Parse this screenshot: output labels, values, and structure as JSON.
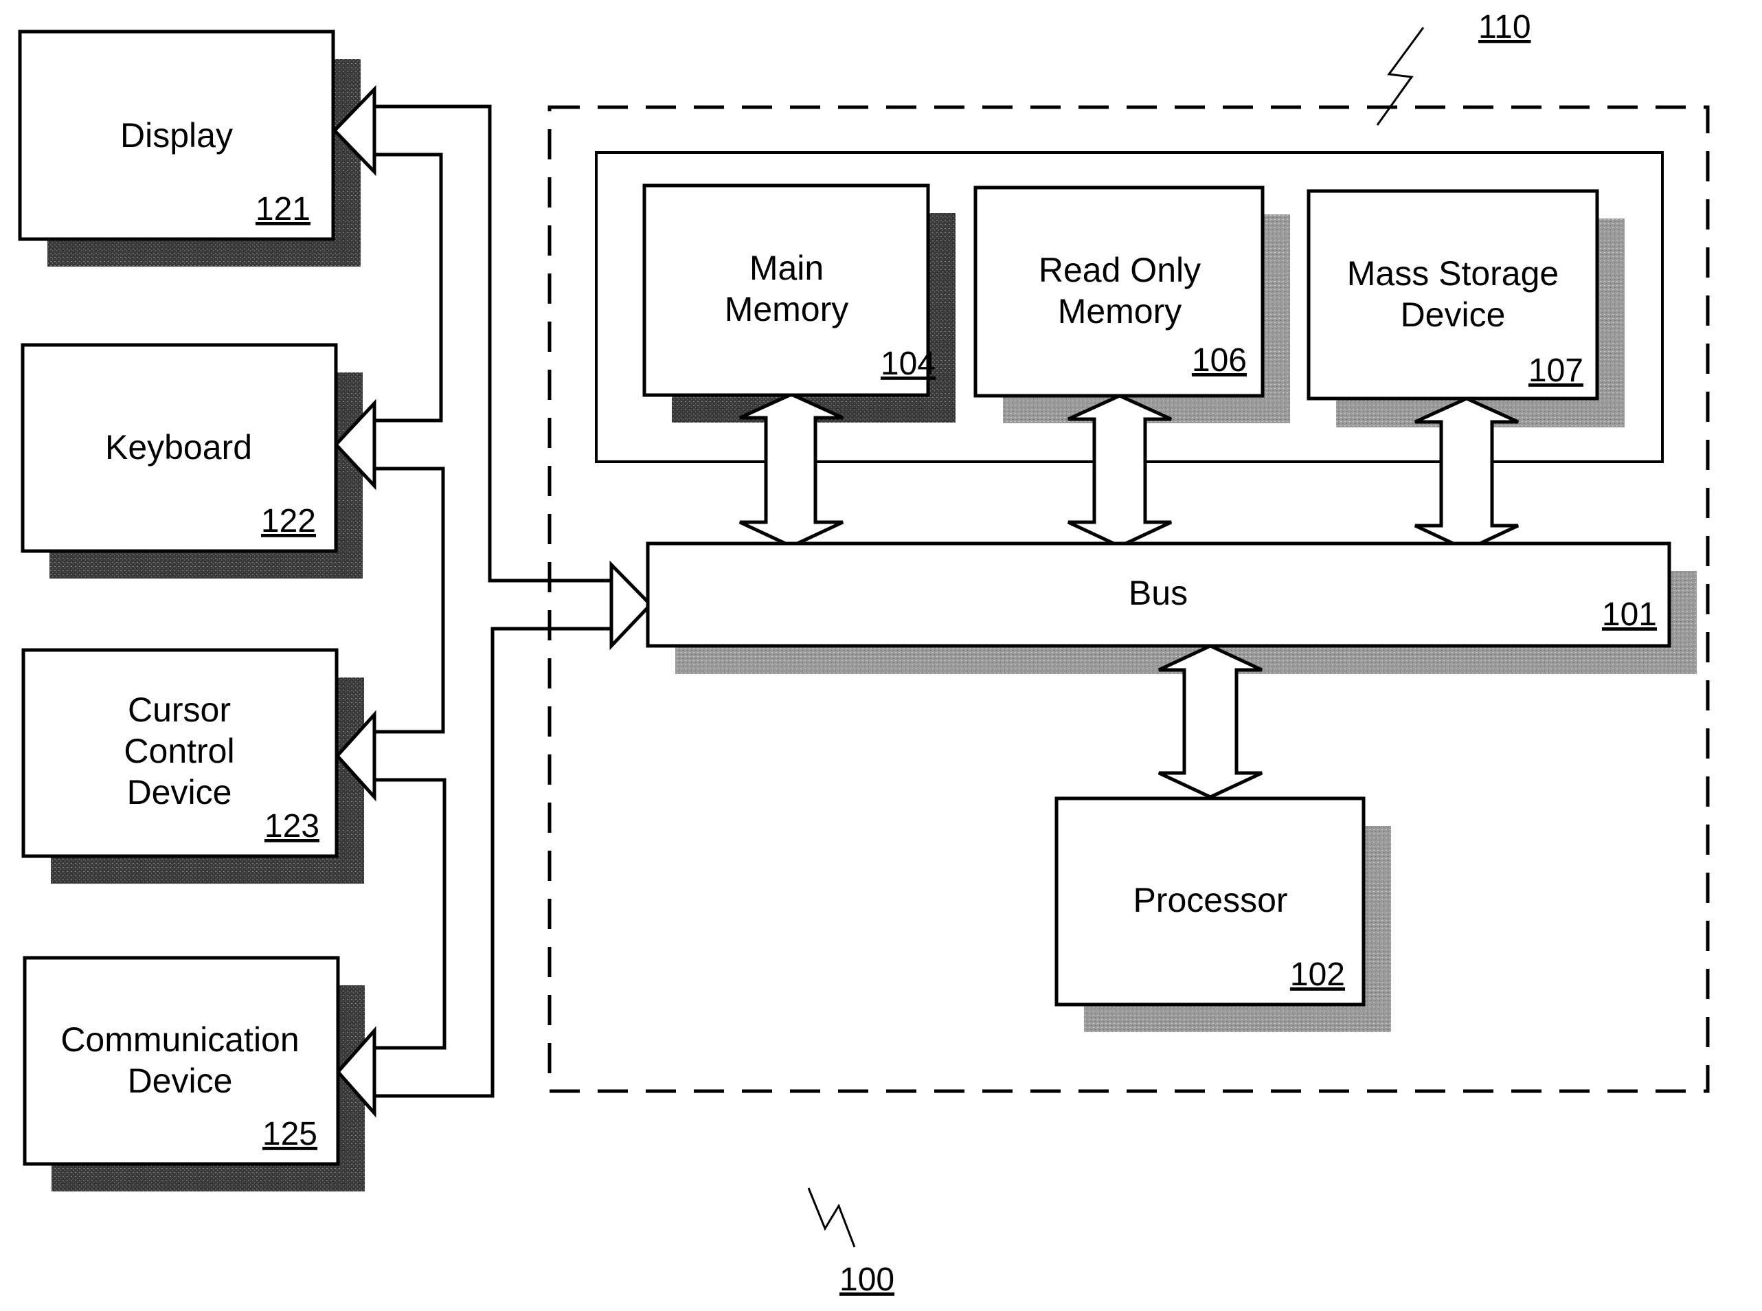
{
  "figure": {
    "system_ref": "100",
    "enclosure_ref": "110"
  },
  "blocks": [
    {
      "id": "display",
      "lines": [
        "Display"
      ],
      "ref": "121"
    },
    {
      "id": "keyboard",
      "lines": [
        "Keyboard"
      ],
      "ref": "122"
    },
    {
      "id": "cursor-control-device",
      "lines": [
        "Cursor",
        "Control",
        "Device"
      ],
      "ref": "123"
    },
    {
      "id": "communication-device",
      "lines": [
        "Communication",
        "Device"
      ],
      "ref": "125"
    },
    {
      "id": "main-memory",
      "lines": [
        "Main",
        "Memory"
      ],
      "ref": "104"
    },
    {
      "id": "read-only-memory",
      "lines": [
        "Read Only",
        "Memory"
      ],
      "ref": "106"
    },
    {
      "id": "mass-storage-device",
      "lines": [
        "Mass Storage",
        "Device"
      ],
      "ref": "107"
    },
    {
      "id": "bus",
      "lines": [
        "Bus"
      ],
      "ref": "101"
    },
    {
      "id": "processor",
      "lines": [
        "Processor"
      ],
      "ref": "102"
    }
  ],
  "colors": {
    "line": "#000000",
    "shadow_dark": "#3a3a3a",
    "shadow_light": "#9a9a9a",
    "background": "#ffffff"
  }
}
